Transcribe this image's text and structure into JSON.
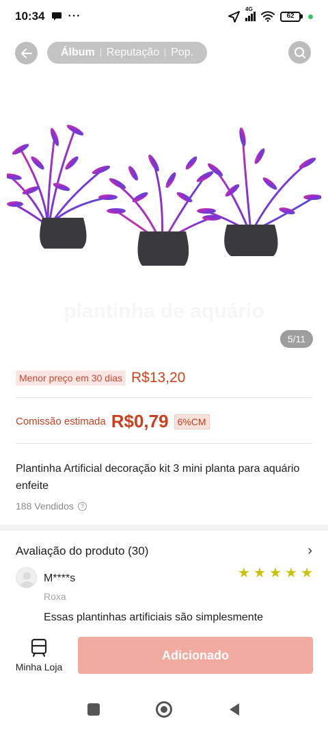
{
  "status_bar": {
    "time": "10:34",
    "network": "4G",
    "battery": "62",
    "icons": [
      "chat-bubble-icon",
      "more-dots-icon",
      "location-icon",
      "signal-icon",
      "wifi-icon",
      "battery-icon"
    ]
  },
  "gallery": {
    "tabs": [
      {
        "label": "Álbum",
        "active": true
      },
      {
        "label": "Reputação",
        "active": false
      },
      {
        "label": "Pop.",
        "active": false
      }
    ],
    "watermark": "plantinha de aquário",
    "counter": "5/11"
  },
  "price": {
    "lowest_badge": "Menor preço em 30 dias",
    "value": "R$13,20"
  },
  "commission": {
    "label": "Comissão estimada",
    "value": "R$0,79",
    "badge": "6%CM"
  },
  "product": {
    "title": "Plantinha Artificial decoração kit 3 mini planta para aquário enfeite",
    "sold": "188 Vendidos"
  },
  "reviews": {
    "header": "Avaliação do produto (30)",
    "items": [
      {
        "user": "M****s",
        "variant": "Roxa",
        "rating": 5,
        "text": "Essas plantinhas artificiais são simplesmente"
      }
    ]
  },
  "bottom_bar": {
    "store_label": "Minha Loja",
    "add_button": "Adicionado"
  },
  "colors": {
    "price_red": "#d0431f",
    "button_disabled": "#f0aa9f",
    "star": "#c9c20a",
    "plant_purple": "#8a2fd0",
    "plant_pink": "#e0339a",
    "plant_blue": "#4a55d8"
  }
}
